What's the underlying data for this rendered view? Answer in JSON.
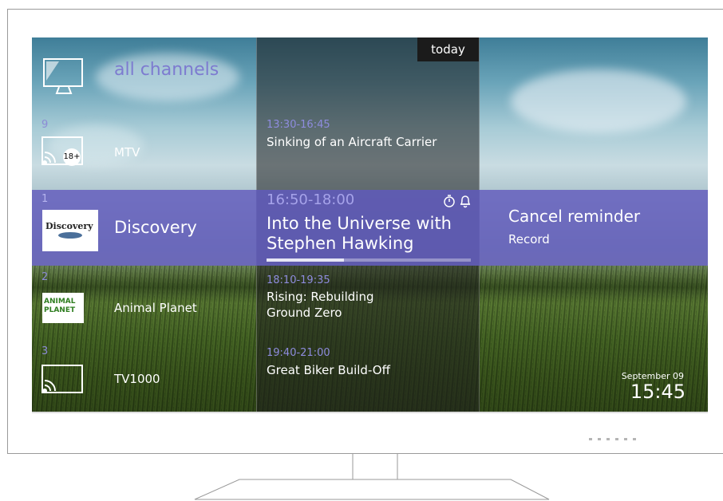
{
  "epg": {
    "today_label": "today",
    "all_channels_label": "all channels",
    "channels": [
      {
        "number": "9",
        "name": "MTV",
        "badge": "18+"
      },
      {
        "number": "1",
        "name": "Discovery",
        "logo_text": "Discovery"
      },
      {
        "number": "2",
        "name": "Animal Planet",
        "logo_text": "ANIMAL PLANET"
      },
      {
        "number": "3",
        "name": "TV1000"
      }
    ],
    "programs": [
      {
        "time": "13:30-16:45",
        "title": "Sinking of an Aircraft Carrier"
      },
      {
        "time": "18:10-19:35",
        "title_line1": "Rising: Rebuilding",
        "title_line2": "Ground Zero"
      },
      {
        "time": "19:40-21:00",
        "title": "Great Biker Build-Off"
      }
    ],
    "selected": {
      "time": "16:50-18:00",
      "title_line1": "Into the Universe with",
      "title_line2": "Stephen Hawking",
      "progress": 0.38,
      "icons": [
        "stopwatch-icon",
        "bell-icon"
      ]
    },
    "actions": {
      "cancel_reminder": "Cancel reminder",
      "record": "Record"
    },
    "status": {
      "date": "September  09",
      "time": "15:45"
    }
  },
  "colors": {
    "accent": "#6862be",
    "time_text": "#8e8cde",
    "channel_number": "#8c8bd6"
  }
}
